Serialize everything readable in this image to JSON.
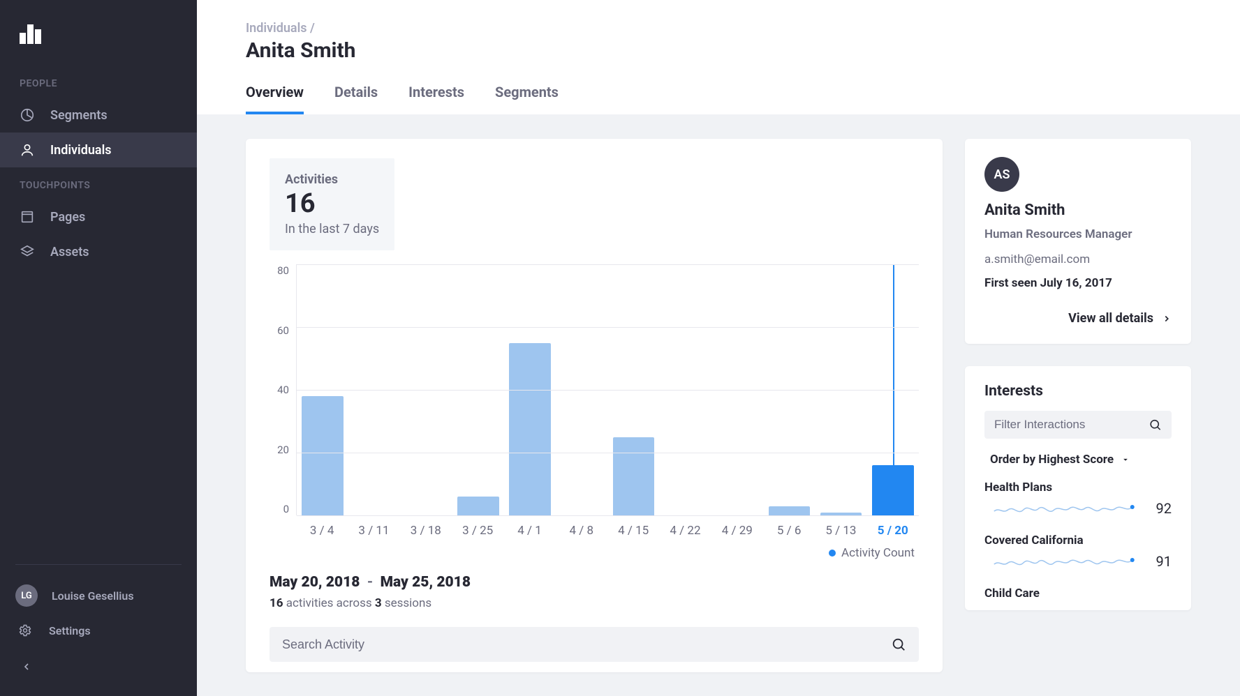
{
  "sidebar": {
    "sections": [
      {
        "label": "PEOPLE",
        "items": [
          {
            "key": "segments",
            "label": "Segments",
            "icon": "pie-icon",
            "active": false
          },
          {
            "key": "individuals",
            "label": "Individuals",
            "icon": "person-icon",
            "active": true
          }
        ]
      },
      {
        "label": "TOUCHPOINTS",
        "items": [
          {
            "key": "pages",
            "label": "Pages",
            "icon": "page-icon",
            "active": false
          },
          {
            "key": "assets",
            "label": "Assets",
            "icon": "layers-icon",
            "active": false
          }
        ]
      }
    ],
    "user": {
      "initials": "LG",
      "name": "Louise Gesellius"
    },
    "settings_label": "Settings"
  },
  "header": {
    "breadcrumb": "Individuals /",
    "title": "Anita Smith",
    "tabs": [
      {
        "label": "Overview",
        "active": true
      },
      {
        "label": "Details",
        "active": false
      },
      {
        "label": "Interests",
        "active": false
      },
      {
        "label": "Segments",
        "active": false
      }
    ]
  },
  "metric": {
    "label": "Activities",
    "value": "16",
    "sub": "In the last 7 days"
  },
  "chart_data": {
    "type": "bar",
    "title": "Activity Count",
    "ylabel": "",
    "xlabel": "",
    "ylim": [
      0,
      80
    ],
    "y_ticks": [
      80,
      60,
      40,
      20,
      0
    ],
    "categories": [
      "3 / 4",
      "3 / 11",
      "3 / 18",
      "3 / 25",
      "4 / 1",
      "4 / 8",
      "4 / 15",
      "4 / 22",
      "4 / 29",
      "5 / 6",
      "5 / 13",
      "5 / 20"
    ],
    "values": [
      38,
      0,
      0,
      6,
      55,
      0,
      25,
      0,
      0,
      3,
      1,
      16
    ],
    "highlight_index": 11,
    "legend": "Activity Count"
  },
  "date_range": {
    "start": "May 20, 2018",
    "end": "May 25, 2018"
  },
  "activity_summary": {
    "activities": "16",
    "mid": " activities across ",
    "sessions": "3",
    "tail": " sessions"
  },
  "search_activity_placeholder": "Search Activity",
  "profile": {
    "initials": "AS",
    "name": "Anita Smith",
    "role": "Human Resources Manager",
    "email": "a.smith@email.com",
    "first_seen": "First seen July 16, 2017",
    "view_all": "View all details"
  },
  "interests": {
    "title": "Interests",
    "filter_placeholder": "Filter Interactions",
    "sort_label": "Order by Highest Score",
    "items": [
      {
        "name": "Health Plans",
        "score": "92"
      },
      {
        "name": "Covered California",
        "score": "91"
      },
      {
        "name": "Child Care",
        "score": ""
      }
    ]
  }
}
